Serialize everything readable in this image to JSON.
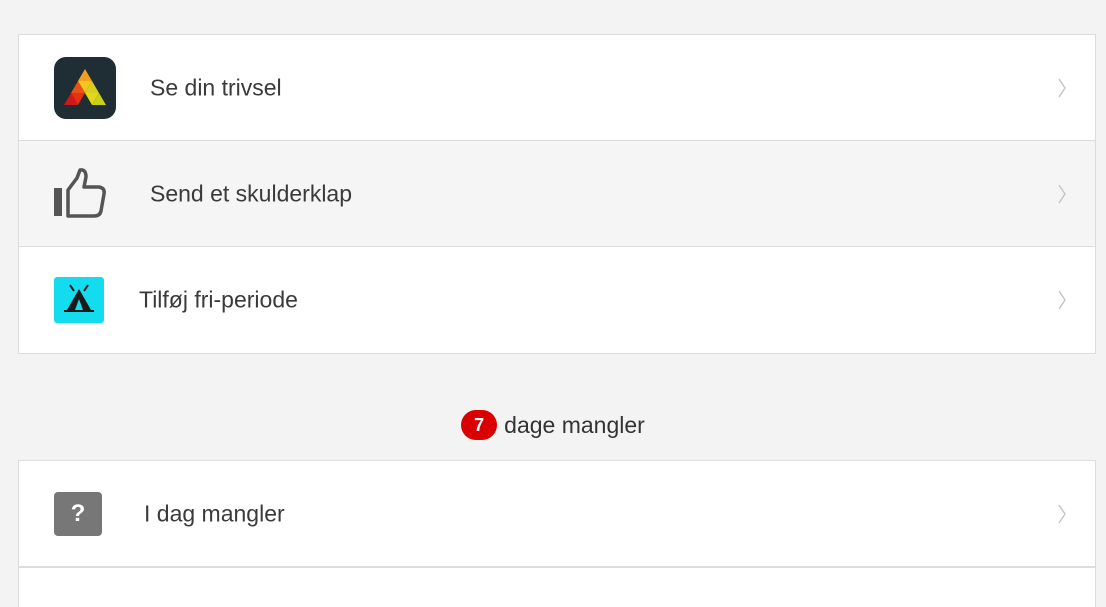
{
  "menu": {
    "items": [
      {
        "label": "Se din trivsel",
        "icon": "trivsel-app-icon"
      },
      {
        "label": "Send et skulderklap",
        "icon": "thumbs-up-icon"
      },
      {
        "label": "Tilføj fri-periode",
        "icon": "tent-icon"
      }
    ]
  },
  "missing": {
    "count": "7",
    "text": "dage mangler"
  },
  "missing_list": {
    "items": [
      {
        "label": "I dag mangler",
        "icon": "question-icon",
        "glyph": "?"
      }
    ]
  },
  "colors": {
    "badge": "#d90000",
    "tent_bg": "#13dcee",
    "app_icon_bg": "#1f2d34",
    "question_bg": "#777777"
  }
}
